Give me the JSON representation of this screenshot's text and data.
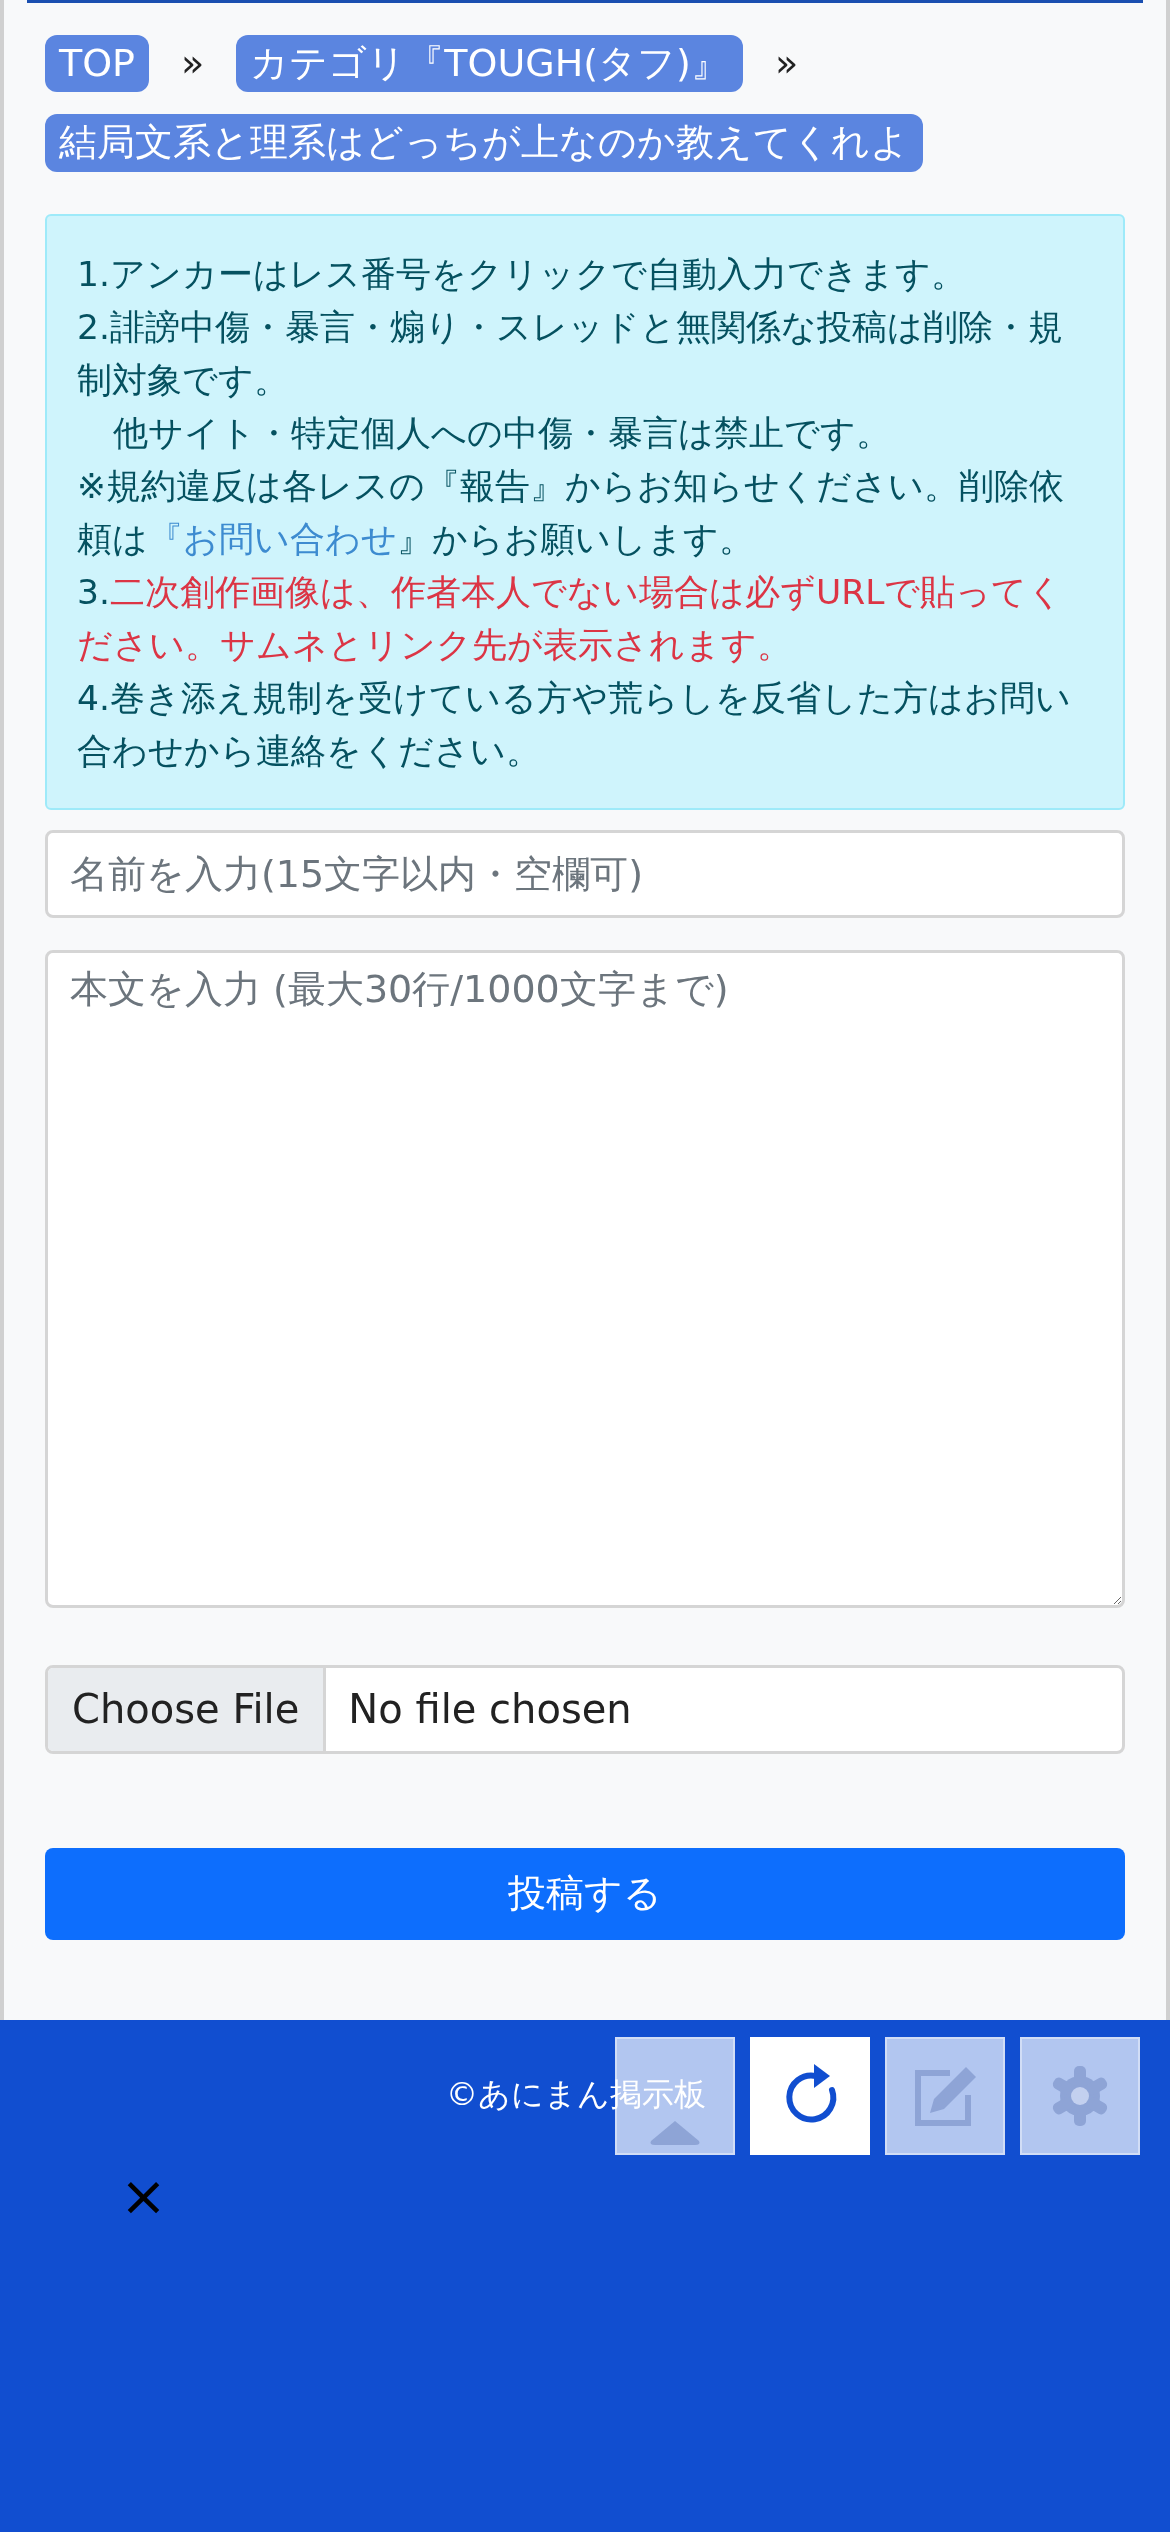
{
  "breadcrumb": [
    {
      "label": "TOP",
      "separator": "»"
    },
    {
      "label": "カテゴリ『TOUGH(タフ)』",
      "separator": "»"
    },
    {
      "label": "結局文系と理系はどっちが上なのか教えてくれよ"
    }
  ],
  "notice": [
    [
      {
        "kind": "plain",
        "text": "1.アンカーはレス番号をクリックで自動入力できます。"
      }
    ],
    [
      {
        "kind": "plain",
        "text": "2.誹謗中傷・暴言・煽り・スレッドと無関係な投稿は削除・規制対象です。"
      }
    ],
    [
      {
        "kind": "indent",
        "text": "他サイト・特定個人への中傷・暴言は禁止です。"
      }
    ],
    [
      {
        "kind": "plain",
        "text": "※規約違反は各レスの『報告』からお知らせください。削除依頼は"
      },
      {
        "kind": "link",
        "text": "『お問い合わせ"
      },
      {
        "kind": "plain",
        "text": "』からお願いします。"
      }
    ],
    [
      {
        "kind": "plain",
        "text": "3."
      },
      {
        "kind": "warning",
        "text": "二次創作画像は、作者本人でない場合は必ずURLで貼ってください。サムネとリンク先が表示されます。"
      }
    ],
    [
      {
        "kind": "plain",
        "text": "4.巻き添え規制を受けている方や荒らしを反省した方はお問い合わせから連絡をください。"
      }
    ]
  ],
  "form": {
    "name_placeholder": "名前を入力(15文字以内・空欄可)",
    "body_placeholder": "本文を入力 (最大30行/1000文字まで)",
    "file_button": "Choose File",
    "file_status": "No file chosen",
    "submit": "投稿する"
  },
  "footer": {
    "copyright": "©あにまん掲示板",
    "close": "×",
    "buttons": [
      {
        "kind": "up",
        "disabled": true
      },
      {
        "kind": "reload",
        "disabled": false
      },
      {
        "kind": "edit",
        "disabled": true
      },
      {
        "kind": "settings",
        "disabled": true
      }
    ]
  }
}
